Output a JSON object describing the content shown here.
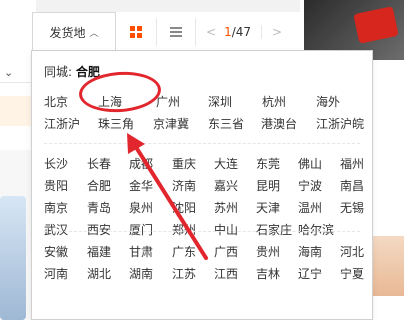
{
  "toolbar": {
    "ship_from": "发货地",
    "page_current": "1",
    "page_total": "/47"
  },
  "dropdown": {
    "same_city_label": "同城:",
    "same_city_value": "合肥",
    "groups": [
      [
        [
          "北京",
          "上海",
          "广州",
          "深圳",
          "杭州",
          "海外"
        ],
        [
          "江浙沪",
          "珠三角",
          "京津冀",
          "东三省",
          "港澳台",
          "江浙沪皖"
        ]
      ],
      [
        [
          "长沙",
          "长春",
          "成都",
          "重庆",
          "大连",
          "东莞",
          "佛山",
          "福州"
        ],
        [
          "贵阳",
          "合肥",
          "金华",
          "济南",
          "嘉兴",
          "昆明",
          "宁波",
          "南昌"
        ],
        [
          "南京",
          "青岛",
          "泉州",
          "沈阳",
          "苏州",
          "天津",
          "温州",
          "无锡"
        ],
        [
          "武汉",
          "西安",
          "厦门",
          "郑州",
          "中山",
          "石家庄",
          "哈尔滨"
        ]
      ],
      [
        [
          "安徽",
          "福建",
          "甘肃",
          "广东",
          "广西",
          "贵州",
          "海南",
          "河北"
        ],
        [
          "河南",
          "湖北",
          "湖南",
          "江苏",
          "江西",
          "吉林",
          "辽宁",
          "宁夏"
        ]
      ]
    ]
  },
  "highlight_color": "#e2262d",
  "accent_color": "#ff4e00"
}
